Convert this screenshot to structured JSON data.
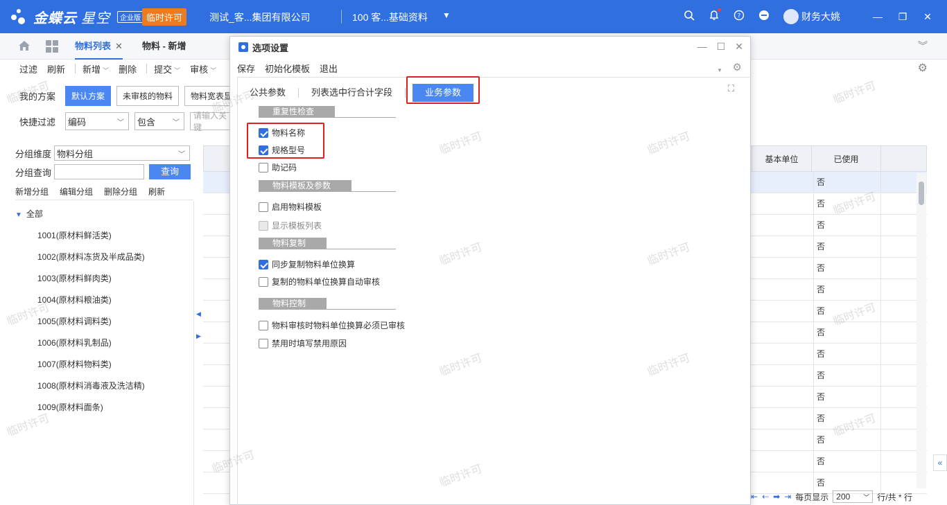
{
  "topbar": {
    "brand": "金蝶云",
    "brand_sub": "星空",
    "edition": "企业版",
    "license": "临时许可",
    "org": "测试_客...集团有限公司",
    "account": "100 客...基础资料",
    "user": "财务大姚"
  },
  "tabs": {
    "list_tab": "物料列表",
    "new_tab": "物料 - 新增"
  },
  "toolbar": [
    "过滤",
    "刷新",
    "新增",
    "删除",
    "提交",
    "审核"
  ],
  "left": {
    "my_scheme_label": "我的方案",
    "schemes": [
      "默认方案",
      "未审核的物料",
      "物料宽表显"
    ],
    "quick_filter_label": "快捷过滤",
    "filter_field": "编码",
    "filter_op": "包含",
    "filter_placeholder": "请输入关键",
    "group_dim_label": "分组维度",
    "group_dim_value": "物料分组",
    "group_query_label": "分组查询",
    "query_button": "查询",
    "group_actions": [
      "新增分组",
      "编辑分组",
      "删除分组",
      "刷新"
    ],
    "tree_root": "全部",
    "tree_items": [
      "1001(原材料鲜活类)",
      "1002(原材料冻货及半成品类)",
      "1003(原材料鲜肉类)",
      "1004(原材料粮油类)",
      "1005(原材料调料类)",
      "1006(原材料乳制品)",
      "1007(原材料物料类)",
      "1008(原材料消毒液及洗洁精)",
      "1009(原材料面条)"
    ]
  },
  "grid": {
    "col_unit": "基本单位",
    "col_used": "已使用",
    "used_values": [
      "否",
      "否",
      "否",
      "否",
      "否",
      "否",
      "否",
      "否",
      "否",
      "否",
      "否",
      "否",
      "否",
      "否",
      "否"
    ],
    "page_size_label": "每页显示",
    "page_size": "200",
    "rows_total": "行/共 * 行"
  },
  "watermark": "临时许可",
  "dialog": {
    "title": "选项设置",
    "toolbar": [
      "保存",
      "初始化模板",
      "退出"
    ],
    "tabs": [
      "公共参数",
      "列表选中行合计字段",
      "业务参数"
    ],
    "groups": [
      {
        "title": "重复性检查",
        "options": [
          {
            "label": "物料名称",
            "checked": true,
            "disabled": false
          },
          {
            "label": "规格型号",
            "checked": true,
            "disabled": false
          },
          {
            "label": "助记码",
            "checked": false,
            "disabled": false
          }
        ]
      },
      {
        "title": "物料模板及参数",
        "options": [
          {
            "label": "启用物料模板",
            "checked": false,
            "disabled": false
          },
          {
            "label": "显示模板列表",
            "checked": false,
            "disabled": true
          }
        ]
      },
      {
        "title": "物料复制",
        "options": [
          {
            "label": "同步复制物料单位换算",
            "checked": true,
            "disabled": false
          },
          {
            "label": "复制的物料单位换算自动审核",
            "checked": false,
            "disabled": false
          }
        ]
      },
      {
        "title": "物料控制",
        "options": [
          {
            "label": "物料审核时物料单位换算必须已审核",
            "checked": false,
            "disabled": false
          },
          {
            "label": "禁用时填写禁用原因",
            "checked": false,
            "disabled": false
          }
        ]
      }
    ]
  },
  "colors": {
    "primary": "#2f6fe0",
    "accent": "#4b87f0",
    "license_badge": "#f07b1e",
    "highlight_box": "#e02020"
  }
}
